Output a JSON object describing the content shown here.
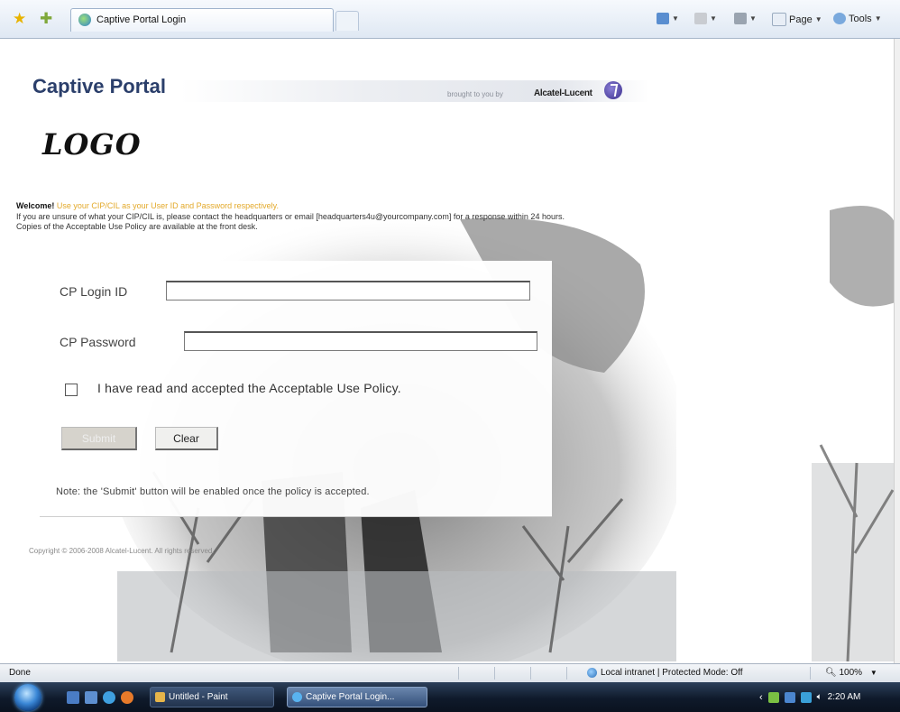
{
  "browser": {
    "tab_title": "Captive Portal Login",
    "commands": [
      "Page",
      "Tools"
    ]
  },
  "header": {
    "title": "Captive Portal",
    "brought_by": "brought to you by",
    "company": "Alcatel-Lucent"
  },
  "logo_text": "LOGO",
  "welcome": {
    "lead": "Welcome!",
    "highlight": "Use your CIP/CIL as your User ID and Password respectively.",
    "line2": "If you are unsure of what your CIP/CIL is, please contact the headquarters or email [headquarters4u@yourcompany.com] for a response within 24 hours.",
    "line3": "Copies of the Acceptable Use Policy are available at the front desk."
  },
  "form": {
    "login_label": "CP Login ID",
    "login_value": "",
    "password_label": "CP Password",
    "password_value": "",
    "policy_label": "I have read and accepted the Acceptable Use Policy.",
    "policy_checked": false,
    "submit_label": "Submit",
    "clear_label": "Clear",
    "note": "Note: the 'Submit' button will be enabled once the policy is accepted."
  },
  "footer": {
    "copyright": "Copyright © 2006-2008 Alcatel-Lucent. All rights reserved."
  },
  "status_bar": {
    "status": "Done",
    "zone": "Local intranet | Protected Mode: Off",
    "zoom": "100%"
  },
  "taskbar": {
    "tasks": [
      "Untitled - Paint",
      "Captive Portal Login..."
    ],
    "clock": "2:20 AM"
  },
  "colors": {
    "title": "#2b3f6b",
    "highlight": "#e3a92a",
    "taskbar": "#0f1a2b"
  }
}
